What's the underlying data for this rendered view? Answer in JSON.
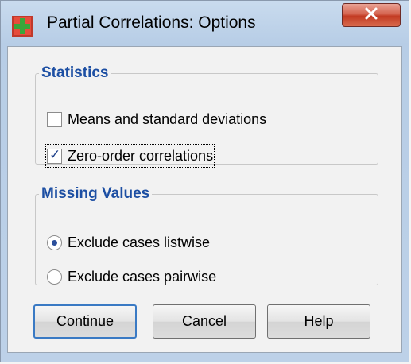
{
  "window": {
    "title": "Partial Correlations: Options"
  },
  "icons": {
    "app": "spss-app-icon",
    "close": "close-icon"
  },
  "colors": {
    "group_title": "#1d4fa3",
    "close_button": "#c23a22"
  },
  "statistics": {
    "title": "Statistics",
    "options": [
      {
        "label": "Means and standard deviations",
        "checked": false
      },
      {
        "label": "Zero-order correlations",
        "checked": true
      }
    ]
  },
  "missing_values": {
    "title": "Missing Values",
    "options": [
      {
        "label": "Exclude cases listwise",
        "selected": true
      },
      {
        "label": "Exclude cases pairwise",
        "selected": false
      }
    ]
  },
  "buttons": {
    "continue": "Continue",
    "cancel": "Cancel",
    "help": "Help"
  }
}
